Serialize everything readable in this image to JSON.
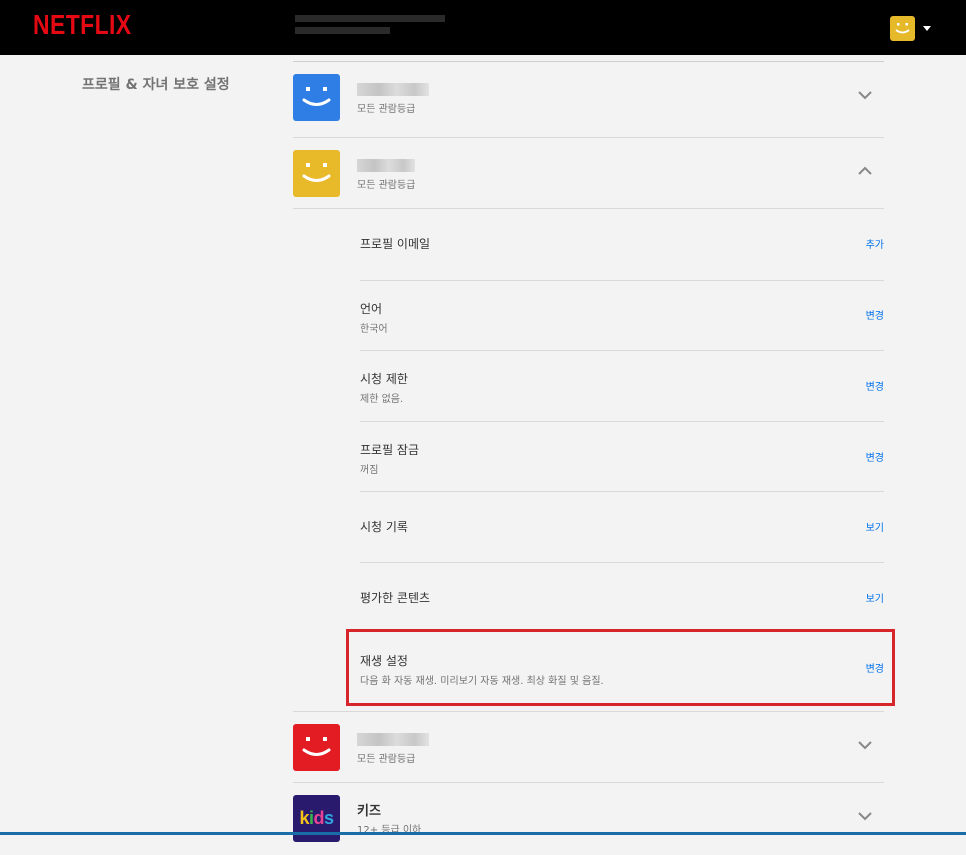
{
  "header": {
    "logo_text": "NETFLIX",
    "brand_color": "#e50914",
    "account_avatar_color": "#e6b92b"
  },
  "section": {
    "label": "프로필 & 자녀 보호 설정"
  },
  "profiles": [
    {
      "name": "",
      "rating": "모든 관람등급",
      "avatar_color": "#2f7ee6",
      "expanded": false
    },
    {
      "name": "",
      "rating": "모든 관람등급",
      "avatar_color": "#e8b928",
      "expanded": true
    },
    {
      "name": "",
      "rating": "모든 관람등급",
      "avatar_color": "#e31b23",
      "expanded": false
    },
    {
      "name": "키즈",
      "rating": "12+ 등급 이하",
      "avatar_label": "kids",
      "expanded": false
    }
  ],
  "settings": [
    {
      "title": "프로필 이메일",
      "desc": "",
      "action": "추가"
    },
    {
      "title": "언어",
      "desc": "한국어",
      "action": "변경"
    },
    {
      "title": "시청 제한",
      "desc": "제한 없음.",
      "action": "변경"
    },
    {
      "title": "프로필 잠금",
      "desc": "꺼짐",
      "action": "변경"
    },
    {
      "title": "시청 기록",
      "desc": "",
      "action": "보기"
    },
    {
      "title": "평가한 콘텐츠",
      "desc": "",
      "action": "보기"
    },
    {
      "title": "재생 설정",
      "desc": "다음 화 자동 재생. 미리보기 자동 재생. 최상 화질 및 음질.",
      "action": "변경",
      "highlighted": true
    }
  ],
  "icons": {
    "chevron_collapsed": "chevron-down-icon",
    "chevron_expanded": "chevron-up-icon",
    "account_menu": "caret-down-icon"
  },
  "highlight_color": "#d7262b",
  "link_color": "#0071eb"
}
